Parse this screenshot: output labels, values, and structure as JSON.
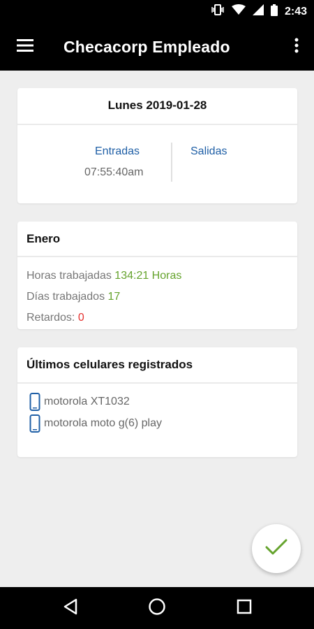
{
  "status_bar": {
    "time": "2:43"
  },
  "app_bar": {
    "title": "Checacorp Empleado"
  },
  "day_card": {
    "title": "Lunes 2019-01-28",
    "entradas_label": "Entradas",
    "entradas_value": "07:55:40am",
    "salidas_label": "Salidas"
  },
  "month_card": {
    "title": "Enero",
    "hours_label": "Horas trabajadas",
    "hours_value": "134:21 Horas",
    "days_label": "Días trabajados",
    "days_value": "17",
    "late_label": "Retardos:",
    "late_value": "0"
  },
  "phones_card": {
    "title": "Últimos celulares registrados",
    "phones": [
      "motorola XT1032",
      "motorola moto g(6) play"
    ]
  },
  "colors": {
    "app_bar": "#000000",
    "background": "#eeeeee",
    "link_blue": "#1f5fa6",
    "positive_green": "#65a32d",
    "negative_red": "#e5322f"
  },
  "icons": [
    "vibrate-icon",
    "wifi-icon",
    "signal-icon",
    "battery-icon",
    "menu-icon",
    "more-vert-icon",
    "phone-icon",
    "check-icon",
    "back-icon",
    "home-icon",
    "recents-icon"
  ]
}
